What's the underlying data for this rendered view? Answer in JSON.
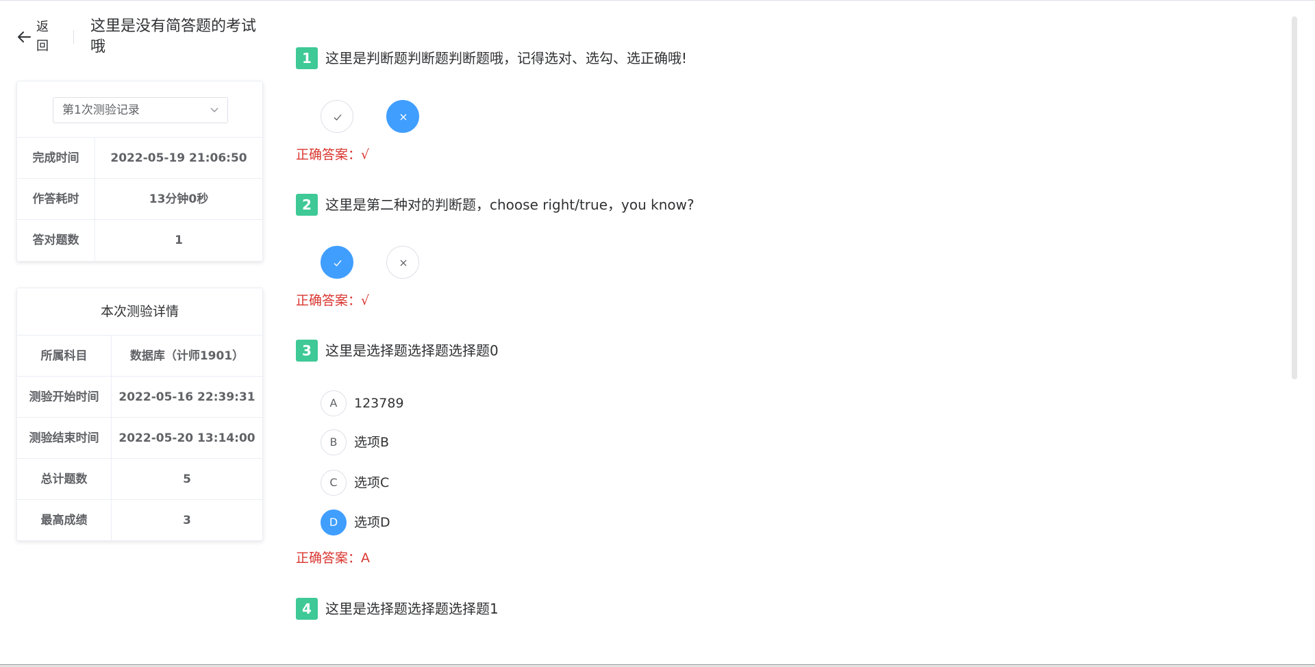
{
  "header": {
    "back_label": "返回",
    "exam_title": "这里是没有简答题的考试哦"
  },
  "record_card": {
    "select_value": "第1次测验记录",
    "rows": [
      {
        "label": "完成时间",
        "value": "2022-05-19 21:06:50"
      },
      {
        "label": "作答耗时",
        "value": "13分钟0秒"
      },
      {
        "label": "答对题数",
        "value": "1"
      }
    ]
  },
  "detail_card": {
    "title": "本次测验详情",
    "rows": [
      {
        "label": "所属科目",
        "value": "数据库（计师1901）"
      },
      {
        "label": "测验开始时间",
        "value": "2022-05-16 22:39:31"
      },
      {
        "label": "测验结束时间",
        "value": "2022-05-20 13:14:00"
      },
      {
        "label": "总计题数",
        "value": "5"
      },
      {
        "label": "最高成绩",
        "value": "3"
      }
    ]
  },
  "questions": [
    {
      "number": "1",
      "text": "这里是判断题判断题判断题哦，记得选对、选勾、选正确哦!",
      "selected": "false",
      "answer": "正确答案：√"
    },
    {
      "number": "2",
      "text": "这里是第二种对的判断题，choose right/true，you know?",
      "selected": "true",
      "answer": "正确答案：√"
    },
    {
      "number": "3",
      "text": "这里是选择题选择题选择题0",
      "options": [
        {
          "letter": "A",
          "text": "123789"
        },
        {
          "letter": "B",
          "text": "选项B"
        },
        {
          "letter": "C",
          "text": "选项C"
        },
        {
          "letter": "D",
          "text": "选项D"
        }
      ],
      "selected": "D",
      "answer": "正确答案：A"
    },
    {
      "number": "4",
      "text": "这里是选择题选择题选择题1"
    }
  ],
  "colors": {
    "accent": "#409eff",
    "badge": "#3ec996",
    "answer": "#d9352f"
  }
}
